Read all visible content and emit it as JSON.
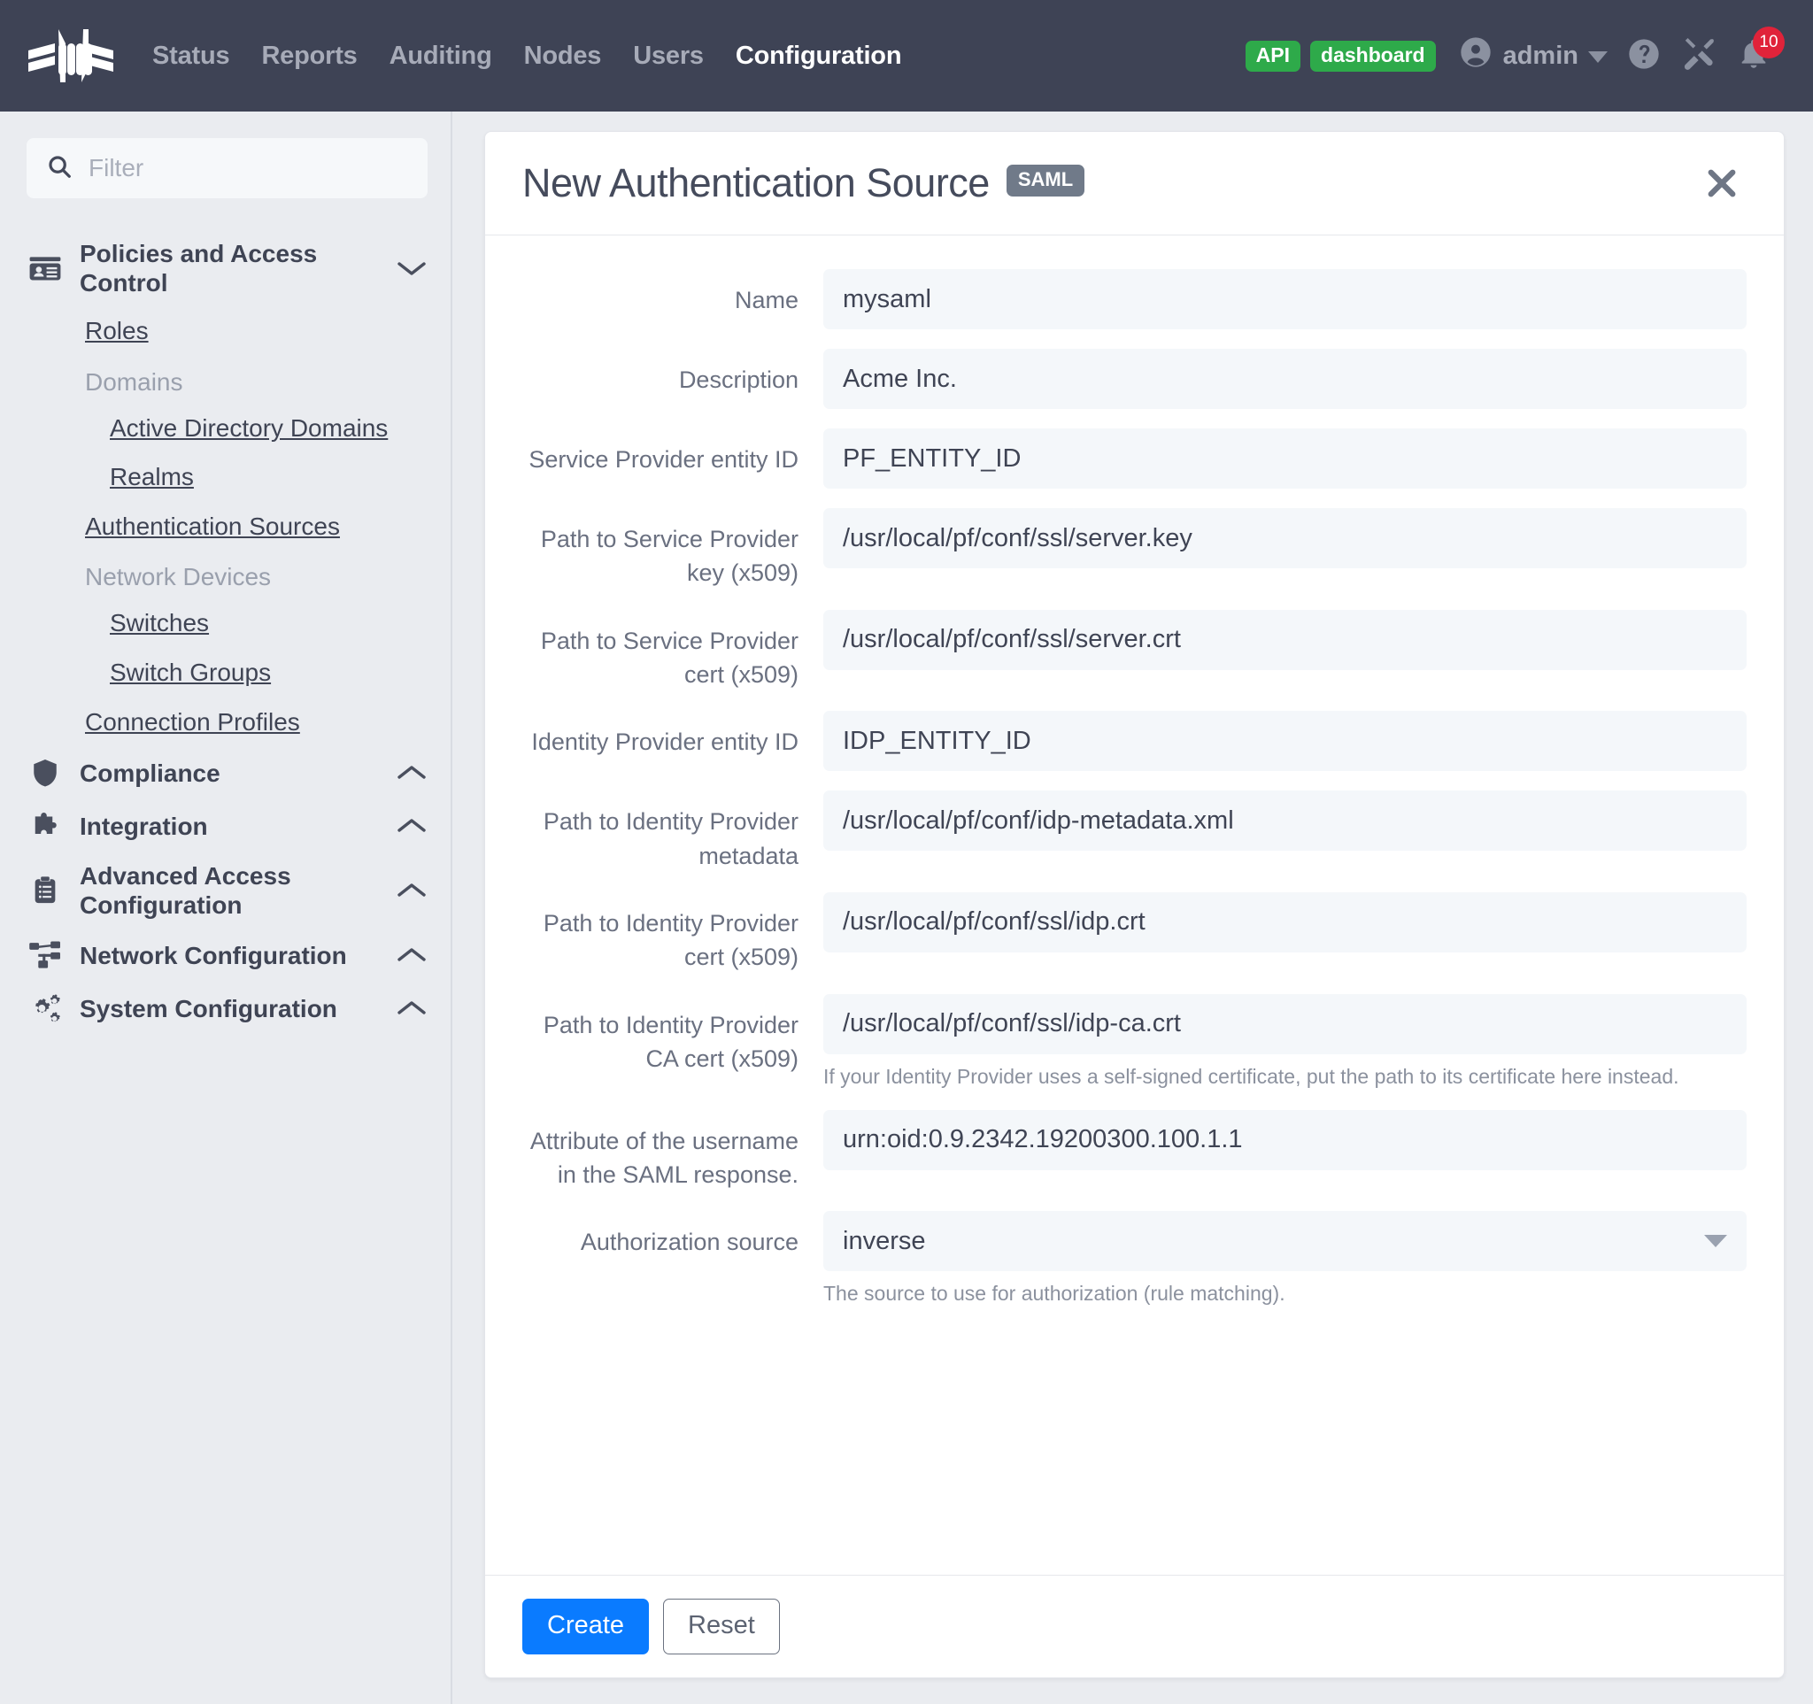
{
  "navbar": {
    "logo_name": "packetfence-logo",
    "links": [
      {
        "label": "Status",
        "active": false
      },
      {
        "label": "Reports",
        "active": false
      },
      {
        "label": "Auditing",
        "active": false
      },
      {
        "label": "Nodes",
        "active": false
      },
      {
        "label": "Users",
        "active": false
      },
      {
        "label": "Configuration",
        "active": true
      }
    ],
    "badges": [
      {
        "label": "API",
        "color": "#2eaa4a"
      },
      {
        "label": "dashboard",
        "color": "#2eaa4a"
      }
    ],
    "user": "admin",
    "notification_count": "10",
    "accent_green": "#2eaa4a",
    "accent_red": "#e0233a"
  },
  "sidebar": {
    "filter_placeholder": "Filter",
    "filter_value": "",
    "groups": [
      {
        "label": "Policies and Access Control",
        "icon": "id-card-icon",
        "expanded": true,
        "chevron": "down",
        "items": [
          {
            "label": "Roles",
            "type": "link"
          },
          {
            "label": "Domains",
            "type": "header"
          },
          {
            "label": "Active Directory Domains",
            "type": "link",
            "indent": true
          },
          {
            "label": "Realms",
            "type": "link",
            "indent": true
          },
          {
            "label": "Authentication Sources",
            "type": "link"
          },
          {
            "label": "Network Devices",
            "type": "header"
          },
          {
            "label": "Switches",
            "type": "link",
            "indent": true
          },
          {
            "label": "Switch Groups",
            "type": "link",
            "indent": true
          },
          {
            "label": "Connection Profiles",
            "type": "link"
          }
        ]
      },
      {
        "label": "Compliance",
        "icon": "shield-icon",
        "expanded": false,
        "chevron": "up",
        "items": []
      },
      {
        "label": "Integration",
        "icon": "puzzle-icon",
        "expanded": false,
        "chevron": "up",
        "items": []
      },
      {
        "label": "Advanced Access Configuration",
        "icon": "clipboard-icon",
        "expanded": false,
        "chevron": "up",
        "items": []
      },
      {
        "label": "Network Configuration",
        "icon": "sitemap-icon",
        "expanded": false,
        "chevron": "up",
        "items": []
      },
      {
        "label": "System Configuration",
        "icon": "gears-icon",
        "expanded": false,
        "chevron": "up",
        "items": []
      }
    ]
  },
  "modal": {
    "title": "New Authentication Source",
    "type_badge": "SAML",
    "close_label": "×",
    "fields": [
      {
        "label": "Name",
        "value": "mysaml",
        "control": "input",
        "help": ""
      },
      {
        "label": "Description",
        "value": "Acme Inc.",
        "control": "input",
        "help": ""
      },
      {
        "label": "Service Provider entity ID",
        "value": "PF_ENTITY_ID",
        "control": "input",
        "help": ""
      },
      {
        "label": "Path to Service Provider key (x509)",
        "value": "/usr/local/pf/conf/ssl/server.key",
        "control": "input",
        "help": ""
      },
      {
        "label": "Path to Service Provider cert (x509)",
        "value": "/usr/local/pf/conf/ssl/server.crt",
        "control": "input",
        "help": ""
      },
      {
        "label": "Identity Provider entity ID",
        "value": "IDP_ENTITY_ID",
        "control": "input",
        "help": ""
      },
      {
        "label": "Path to Identity Provider metadata",
        "value": "/usr/local/pf/conf/idp-metadata.xml",
        "control": "input",
        "help": ""
      },
      {
        "label": "Path to Identity Provider cert (x509)",
        "value": "/usr/local/pf/conf/ssl/idp.crt",
        "control": "input",
        "help": ""
      },
      {
        "label": "Path to Identity Provider CA cert (x509)",
        "value": "/usr/local/pf/conf/ssl/idp-ca.crt",
        "control": "input",
        "help": "If your Identity Provider uses a self-signed certificate, put the path to its certificate here instead."
      },
      {
        "label": "Attribute of the username in the SAML response.",
        "value": "urn:oid:0.9.2342.19200300.100.1.1",
        "control": "input",
        "help": ""
      },
      {
        "label": "Authorization source",
        "value": "inverse",
        "control": "select",
        "help": "The source to use for authorization (rule matching)."
      }
    ],
    "footer": {
      "create_label": "Create",
      "reset_label": "Reset",
      "primary_color": "#0a7bff"
    }
  }
}
